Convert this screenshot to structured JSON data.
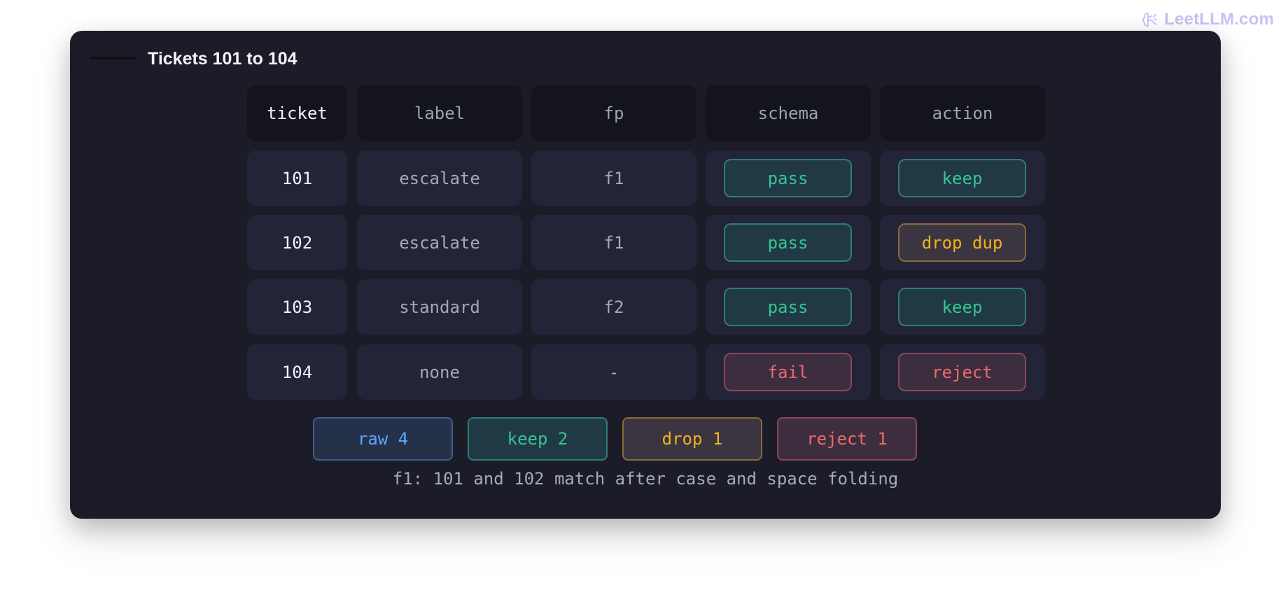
{
  "brand": {
    "text": "LeetLLM.com",
    "icon": "brain-icon",
    "color": "#c8c1f5"
  },
  "panel": {
    "title": "Tickets 101 to 104"
  },
  "table": {
    "columns": [
      "ticket",
      "label",
      "fp",
      "schema",
      "action"
    ],
    "rows": [
      {
        "ticket": "101",
        "label": "escalate",
        "fp": "f1",
        "schema": "pass",
        "schema_tone": "green",
        "action": "keep",
        "action_tone": "green"
      },
      {
        "ticket": "102",
        "label": "escalate",
        "fp": "f1",
        "schema": "pass",
        "schema_tone": "green",
        "action": "drop dup",
        "action_tone": "amber"
      },
      {
        "ticket": "103",
        "label": "standard",
        "fp": "f2",
        "schema": "pass",
        "schema_tone": "green",
        "action": "keep",
        "action_tone": "green"
      },
      {
        "ticket": "104",
        "label": "none",
        "fp": "-",
        "schema": "fail",
        "schema_tone": "red",
        "action": "reject",
        "action_tone": "red"
      }
    ]
  },
  "summary": [
    {
      "label": "raw 4",
      "tone": "blue"
    },
    {
      "label": "keep 2",
      "tone": "green"
    },
    {
      "label": "drop 1",
      "tone": "amber"
    },
    {
      "label": "reject 1",
      "tone": "red"
    }
  ],
  "footnote": "f1: 101 and 102 match after case and space folding",
  "colors": {
    "page_background": "#ffffff",
    "panel_background": "#1c1c28",
    "header_cell": "#14141c",
    "body_cell": "#242439",
    "green": "#35c597",
    "amber": "#f1b31c",
    "red": "#ec6a6a",
    "blue": "#5da7ff"
  }
}
